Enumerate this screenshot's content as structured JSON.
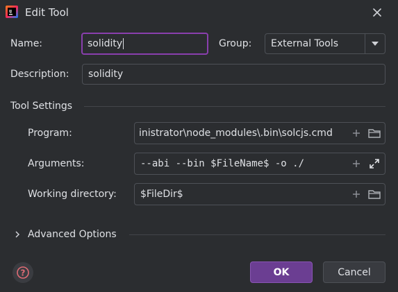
{
  "window": {
    "title": "Edit Tool"
  },
  "form": {
    "name_label": "Name:",
    "name_value": "solidity",
    "group_label": "Group:",
    "group_value": "External Tools",
    "description_label": "Description:",
    "description_value": "solidity"
  },
  "tool_settings": {
    "heading": "Tool Settings",
    "program_label": "Program:",
    "program_value": "inistrator\\node_modules\\.bin\\solcjs.cmd",
    "arguments_label": "Arguments:",
    "arguments_value": "--abi --bin $FileName$ -o ./",
    "workdir_label": "Working directory:",
    "workdir_value": "$FileDir$"
  },
  "advanced": {
    "label": "Advanced Options"
  },
  "footer": {
    "ok_label": "OK",
    "cancel_label": "Cancel"
  },
  "icons": {
    "app": "intellij-app-icon",
    "close": "close-icon",
    "dropdown": "chevron-down-icon",
    "add": "plus-icon",
    "folder": "folder-icon",
    "expand": "expand-icon",
    "help": "help-icon"
  },
  "colors": {
    "background": "#2b2d30",
    "accent": "#8a3fae",
    "ok_button": "#6b3e92",
    "help_icon": "#e06c75"
  }
}
